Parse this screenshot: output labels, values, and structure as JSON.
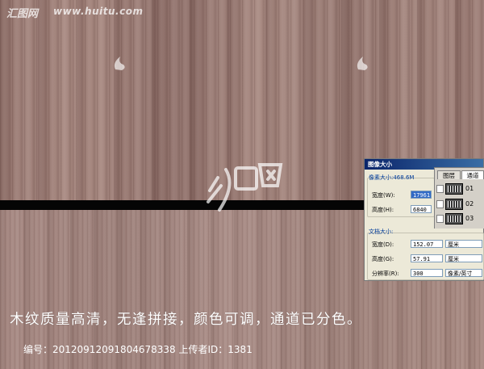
{
  "watermark": {
    "logo_text": "汇图网",
    "url": "www.huitu.com"
  },
  "dialog": {
    "title": "图像大小",
    "pixel_size_label": "像素大小:468.6M",
    "width_label": "宽度(W):",
    "width_value": "17961",
    "height_label": "高度(H):",
    "height_value": "6840",
    "doc_size_label": "文档大小:",
    "doc_width_label": "宽度(D):",
    "doc_width_value": "152.07",
    "doc_width_unit": "厘米",
    "doc_height_label": "高度(G):",
    "doc_height_value": "57.91",
    "doc_height_unit": "厘米",
    "resolution_label": "分辨率(R):",
    "resolution_value": "300",
    "resolution_unit": "像素/英寸"
  },
  "panel": {
    "tabs": [
      "图层",
      "通道"
    ],
    "channels": [
      "01",
      "02",
      "03"
    ]
  },
  "caption": "木纹质量高清，无逢拼接，颜色可调，通道已分色。",
  "info": "编号：20120912091804678338 上传者ID：1381",
  "colors": {
    "wood_top": "#9a7b74",
    "wood_bottom": "#a48680",
    "divider": "#050505",
    "dialog_bg": "#ece9d8"
  }
}
